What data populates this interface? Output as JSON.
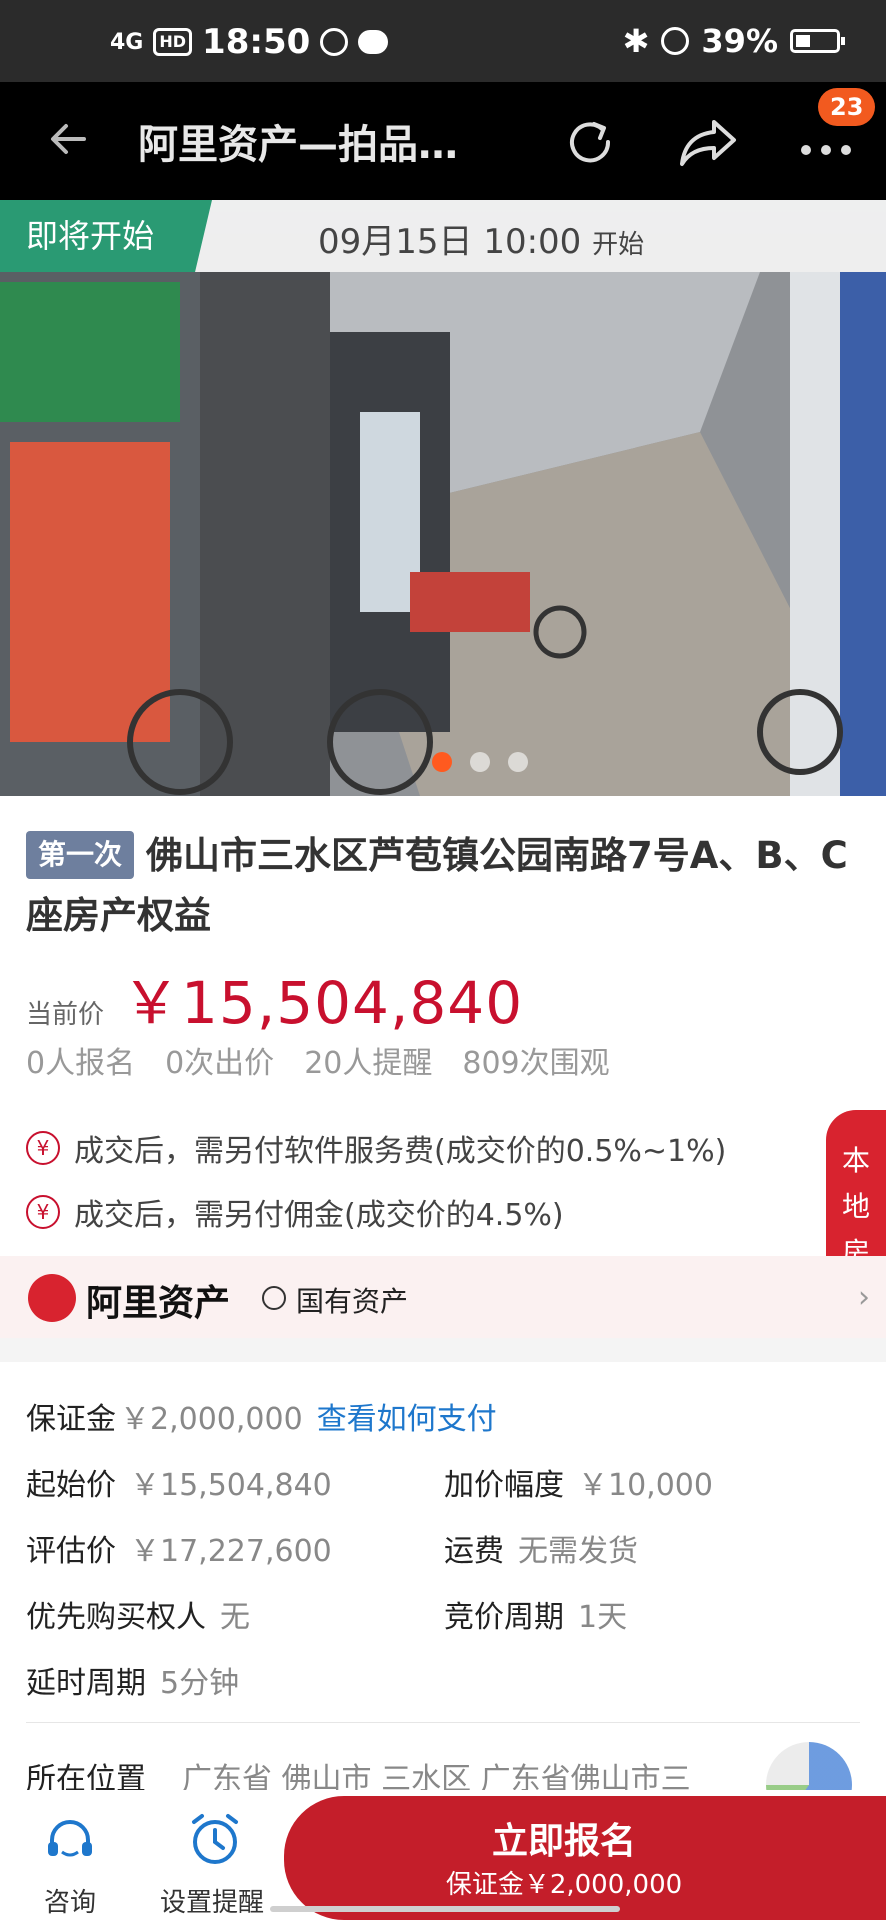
{
  "status_bar": {
    "network": "4G",
    "hd": "HD",
    "time": "18:50",
    "battery": "39%"
  },
  "nav": {
    "title": "阿里资产—拍品…",
    "badge_count": "23"
  },
  "auction": {
    "status_tag": "即将开始",
    "start_time": "09月15日 10:00",
    "start_suffix": "开始",
    "photo_index": 1,
    "photo_total": 3
  },
  "item": {
    "round_tag": "第一次",
    "title": "佛山市三水区芦苞镇公园南路7号A、B、C座房产权益",
    "price_label": "当前价",
    "price": "￥15,504,840",
    "stats": [
      "0人报名",
      "0次出价",
      "20人提醒",
      "809次围观"
    ],
    "fees": [
      {
        "icon": "yuan-icon",
        "text": "成交后，需另付软件服务费(成交价的0.5%~1%)"
      },
      {
        "icon": "yuan-icon",
        "text": "成交后，需另付佣金(成交价的4.5%)"
      }
    ],
    "local_tab": [
      "本",
      "地",
      "房"
    ]
  },
  "platform": {
    "name": "阿里资产",
    "state_asset": "国有资产"
  },
  "details": {
    "deposit_label": "保证金",
    "deposit_value": "￥2,000,000",
    "deposit_link": "查看如何支付",
    "start_price_label": "起始价",
    "start_price_value": "￥15,504,840",
    "increment_label": "加价幅度",
    "increment_value": "￥10,000",
    "appraisal_label": "评估价",
    "appraisal_value": "￥17,227,600",
    "shipping_label": "运费",
    "shipping_value": "无需发货",
    "priority_label": "优先购买权人",
    "priority_value": "无",
    "cycle_label": "竞价周期",
    "cycle_value": "1天",
    "delay_label": "延时周期",
    "delay_value": "5分钟",
    "location_label": "所在位置",
    "location_value": "广东省 佛山市 三水区 广东省佛山市三"
  },
  "bottom_bar": {
    "consult": "咨询",
    "remind": "设置提醒",
    "cta_title": "立即报名",
    "cta_sub": "保证金￥2,000,000"
  },
  "colors": {
    "brand_red": "#c41e2a",
    "price_red": "#c8102e",
    "start_tag_green": "#2a9a73",
    "link_blue": "#1e77cc",
    "badge_orange": "#f25a1f"
  }
}
